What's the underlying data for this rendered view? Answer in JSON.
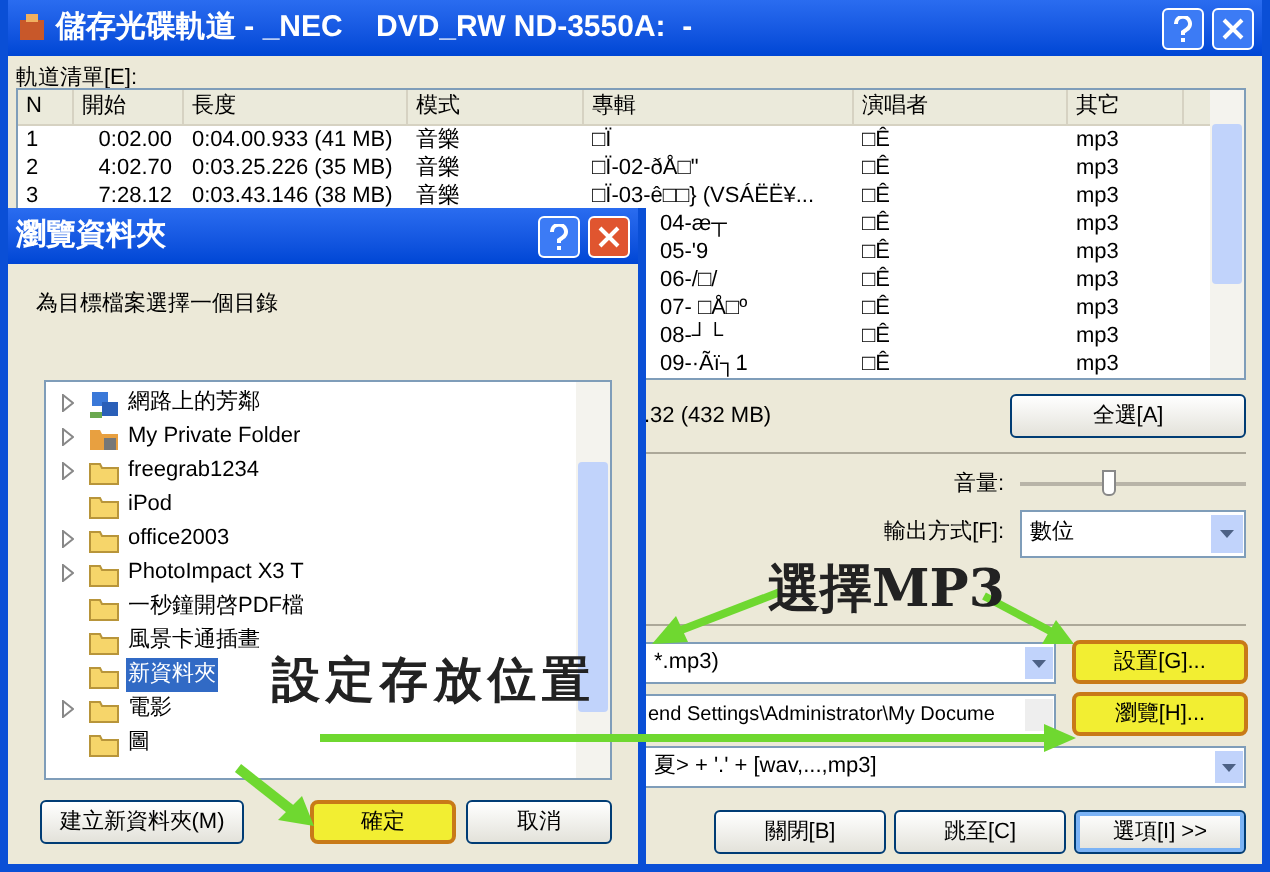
{
  "window": {
    "title": "儲存光碟軌道 - _NEC    DVD_RW ND-3550A:  -"
  },
  "track_list": {
    "label": "軌道清單[E]:",
    "columns": [
      "N",
      "開始",
      "長度",
      "模式",
      "專輯",
      "演唱者",
      "其它"
    ],
    "rows": [
      {
        "cells": [
          "1",
          "0:02.00",
          "0:04.00.933 (41 MB)",
          "音樂",
          "□Ï",
          "□Ê",
          "mp3"
        ]
      },
      {
        "cells": [
          "2",
          "4:02.70",
          "0:03.25.226 (35 MB)",
          "音樂",
          "□Ï-02-ðÅ□\"",
          "□Ê",
          "mp3"
        ]
      },
      {
        "cells": [
          "3",
          "7:28.12",
          "0:03.43.146 (38 MB)",
          "音樂",
          "□Ï-03-ê□□} (VSÁËË¥...",
          "□Ê",
          "mp3"
        ]
      },
      {
        "cells": [
          "",
          "",
          "",
          "",
          "04-æ┬",
          "□Ê",
          "mp3"
        ]
      },
      {
        "cells": [
          "",
          "",
          "",
          "",
          "05-'9",
          "□Ê",
          "mp3"
        ]
      },
      {
        "cells": [
          "",
          "",
          "",
          "",
          "06-/□/",
          "□Ê",
          "mp3"
        ]
      },
      {
        "cells": [
          "",
          "",
          "",
          "",
          "07- □Å□º",
          "□Ê",
          "mp3"
        ]
      },
      {
        "cells": [
          "",
          "",
          "",
          "",
          "08-┘└",
          "□Ê",
          "mp3"
        ]
      },
      {
        "cells": [
          "",
          "",
          "",
          "",
          "09-·Ãï┐1",
          "□Ê",
          "mp3"
        ]
      }
    ]
  },
  "total": ".32 (432 MB)",
  "select_all_button": "全選[A]",
  "volume": {
    "label": "音量:",
    "level": 0.39
  },
  "output_mode": {
    "label": "輸出方式[F]:",
    "value": "數位"
  },
  "format_combo": {
    "value": "*.mp3)"
  },
  "settings_button": "設置[G]...",
  "path_field": {
    "value": "end Settings\\Administrator\\My Docume"
  },
  "browse_button": "瀏覽[H]...",
  "filename_combo": {
    "value": "夏> + '.' + [wav,...,mp3]"
  },
  "bottom_buttons": [
    "關閉[B]",
    "跳至[C]",
    "選項[I] >>"
  ],
  "dialog": {
    "title": "瀏覽資料夾",
    "prompt": "為目標檔案選擇一個目錄",
    "folders": [
      {
        "label": "網路上的芳鄰",
        "kind": "network",
        "expandable": true,
        "selected": false
      },
      {
        "label": "My Private Folder",
        "kind": "private",
        "expandable": true,
        "selected": false
      },
      {
        "label": "freegrab1234",
        "kind": "folder",
        "expandable": true,
        "selected": false
      },
      {
        "label": "iPod",
        "kind": "folder",
        "expandable": false,
        "selected": false
      },
      {
        "label": "office2003",
        "kind": "folder",
        "expandable": true,
        "selected": false
      },
      {
        "label": "PhotoImpact X3 T",
        "kind": "folder",
        "expandable": true,
        "selected": false
      },
      {
        "label": "一秒鐘開啓PDF檔",
        "kind": "folder",
        "expandable": false,
        "selected": false
      },
      {
        "label": "風景卡通插畫",
        "kind": "folder",
        "expandable": false,
        "selected": false
      },
      {
        "label": "新資料夾",
        "kind": "folder",
        "expandable": false,
        "selected": true
      },
      {
        "label": "電影",
        "kind": "folder",
        "expandable": true,
        "selected": false
      },
      {
        "label": "圖",
        "kind": "folder",
        "expandable": false,
        "selected": false
      }
    ],
    "buttons": [
      {
        "label": "建立新資料夾(M)",
        "highlighted": false
      },
      {
        "label": "確定",
        "highlighted": true
      },
      {
        "label": "取消",
        "highlighted": false
      }
    ]
  },
  "annotations": [
    "選擇MP3",
    "設定存放位置"
  ]
}
